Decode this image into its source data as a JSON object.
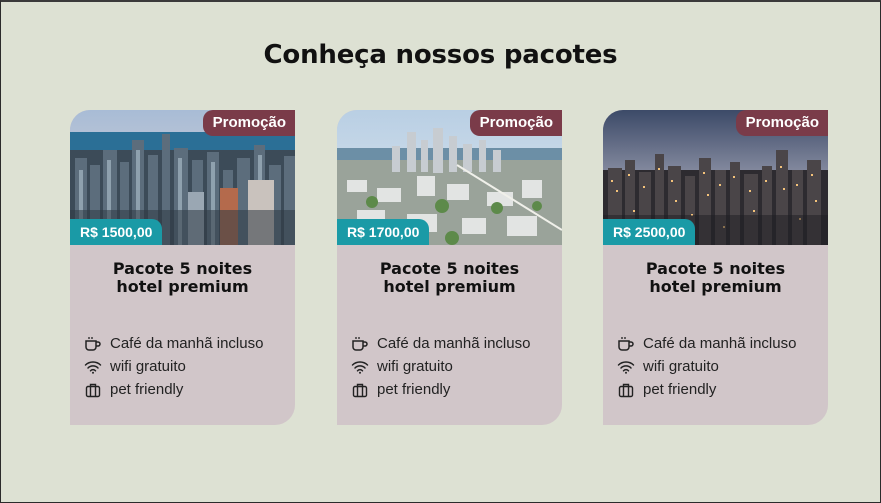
{
  "section": {
    "title": "Conheça nossos pacotes"
  },
  "packages": [
    {
      "badge": "Promoção",
      "price": "R$ 1500,00",
      "name": "Pacote 5 noites hotel premium",
      "features": [
        "Café da manhã incluso",
        "wifi gratuito",
        "pet friendly"
      ],
      "photo": "daytime-city-skyline-with-lake"
    },
    {
      "badge": "Promoção",
      "price": "R$ 1700,00",
      "name": "Pacote 5 noites hotel premium",
      "features": [
        "Café da manhã incluso",
        "wifi gratuito",
        "pet friendly"
      ],
      "photo": "aerial-city-with-park-and-harbor"
    },
    {
      "badge": "Promoção",
      "price": "R$ 2500,00",
      "name": "Pacote 5 noites hotel premium",
      "features": [
        "Café da manhã incluso",
        "wifi gratuito",
        "pet friendly"
      ],
      "photo": "dusk-city-skyline-lights"
    }
  ],
  "icons": [
    "coffee-cup-icon",
    "wifi-icon",
    "suitcase-icon"
  ],
  "colors": {
    "background": "#dde1d3",
    "card": "#d1c6c9",
    "badge": "#7a3b49",
    "price": "#1a9aa6"
  }
}
